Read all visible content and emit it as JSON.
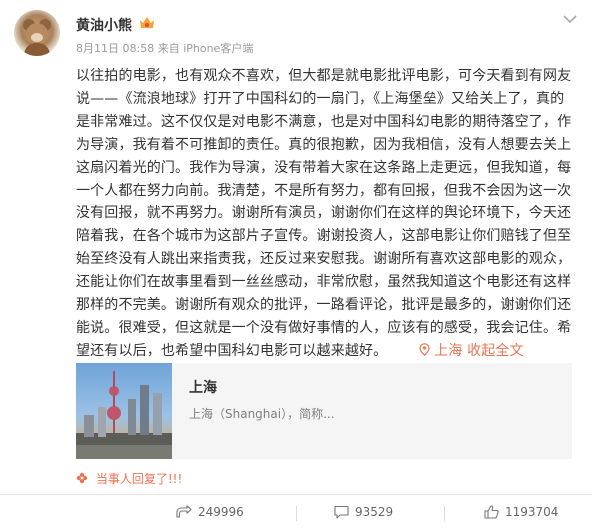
{
  "author": {
    "name": "黄油小熊"
  },
  "meta": {
    "date": "8月11日 08:58",
    "source": "来自 iPhone客户端"
  },
  "post_lines": [
    "以往拍的电影，也有观众不喜欢，但大都是就电影批评电影，可今天看到有网友",
    "说——《流浪地球》打开了中国科幻的一扇门，《上海堡垒》又给关上了，真的",
    "是非常难过。这不仅仅是对电影不满意，也是对中国科幻电影的期待落空了，作",
    "为导演，我有着不可推卸的责任。真的很抱歉，因为我相信，没有人想要去关上",
    "这扇闪着光的门。我作为导演，没有带着大家在这条路上走更远，但我知道，每",
    "一个人都在努力向前。我清楚，不是所有努力，都有回报，但我不会因为这一次",
    "没有回报，就不再努力。谢谢所有演员，谢谢你们在这样的舆论环境下，今天还",
    "陪着我，在各个城市为这部片子宣传。谢谢投资人，这部电影让你们赔钱了但至",
    "始至终没有人跳出来指责我，还反过来安慰我。谢谢所有喜欢这部电影的观众，",
    "还能让你们在故事里看到一丝丝感动，非常欣慰，虽然我知道这个电影还有这样",
    "那样的不完美。谢谢所有观众的批评，一路看评论，批评是最多的，谢谢你们还",
    "能说。很难受，但这就是一个没有做好事情的人，应该有的感受，我会记住。希"
  ],
  "post_last_line": "望还有以后，也希望中国科幻电影可以越来越好。",
  "location_tag": "上海",
  "read_more": "收起全文",
  "card": {
    "title": "上海",
    "subtitle": "上海（Shanghai），简称..."
  },
  "reply_note": "当事人回复了!!!",
  "actions": {
    "share": "249996",
    "comment": "93529",
    "like": "1193704"
  },
  "colors": {
    "accent": "#eb7350",
    "text": "#333333",
    "muted": "#9a9a9a"
  }
}
